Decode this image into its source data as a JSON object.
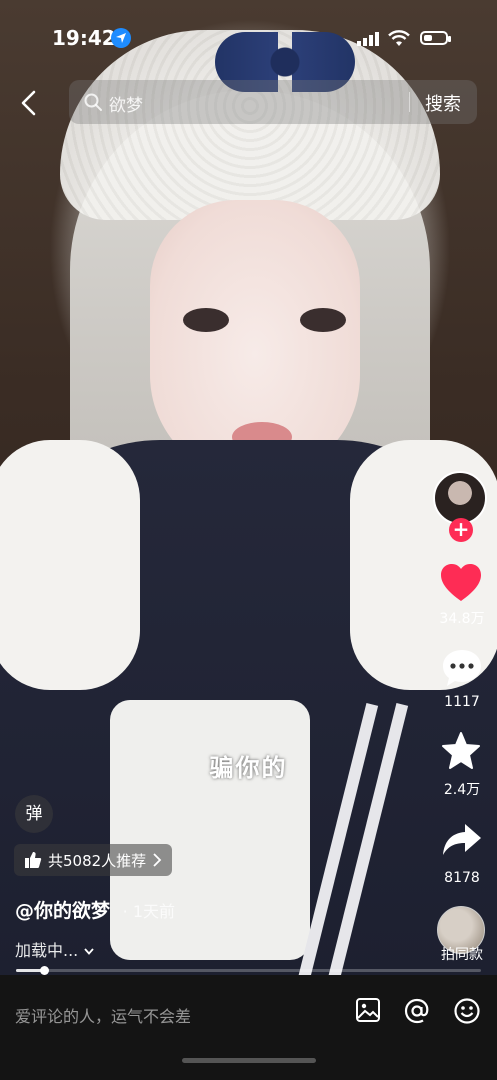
{
  "status_bar": {
    "time": "19:42",
    "battery_level": 0.4
  },
  "search": {
    "query": "欲梦",
    "button_label": "搜索"
  },
  "video": {
    "caption": "骗你的",
    "progress": 0.06
  },
  "right_rail": {
    "likes": "34.8万",
    "comments": "1117",
    "favorites": "2.4万",
    "shares": "8178",
    "remix_label": "拍同款",
    "follow_symbol": "+",
    "colors": {
      "like": "#fe2c55",
      "follow": "#fe2c55"
    }
  },
  "content": {
    "danmaku_label": "弹",
    "recommend_text": "共5082人推荐",
    "author": "@你的欲梦",
    "time": "· 1天前",
    "loading": "加载中..."
  },
  "comment_bar": {
    "placeholder": "爱评论的人，运气不会差",
    "icons": [
      "image-icon",
      "mention-icon",
      "emoji-icon"
    ]
  }
}
